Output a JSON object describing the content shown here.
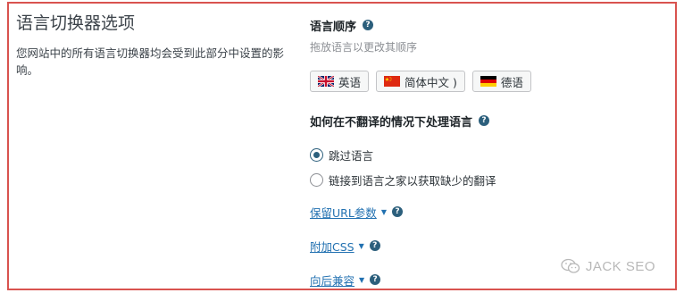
{
  "section": {
    "title": "语言切换器选项",
    "description": "您网站中的所有语言切换器均会受到此部分中设置的影响。"
  },
  "language_order": {
    "label": "语言顺序",
    "help_icon": "question-circle-icon",
    "hint": "拖放语言以更改其顺序",
    "languages": [
      {
        "label": "英语",
        "flag": "uk-flag-icon"
      },
      {
        "label": "简体中文 )",
        "flag": "china-flag-icon"
      },
      {
        "label": "德语",
        "flag": "germany-flag-icon"
      }
    ]
  },
  "untranslated": {
    "label": "如何在不翻译的情况下处理语言",
    "options": [
      {
        "label": "跳过语言",
        "checked": true
      },
      {
        "label": "链接到语言之家以获取缺少的翻译",
        "checked": false
      }
    ]
  },
  "toggles": [
    {
      "label": "保留URL参数"
    },
    {
      "label": "附加CSS"
    },
    {
      "label": "向后兼容"
    }
  ],
  "watermark": {
    "text": "JACK SEO"
  },
  "colors": {
    "frame_border": "#d9534f",
    "accent": "#2c5f7c",
    "link": "#2271b1"
  }
}
